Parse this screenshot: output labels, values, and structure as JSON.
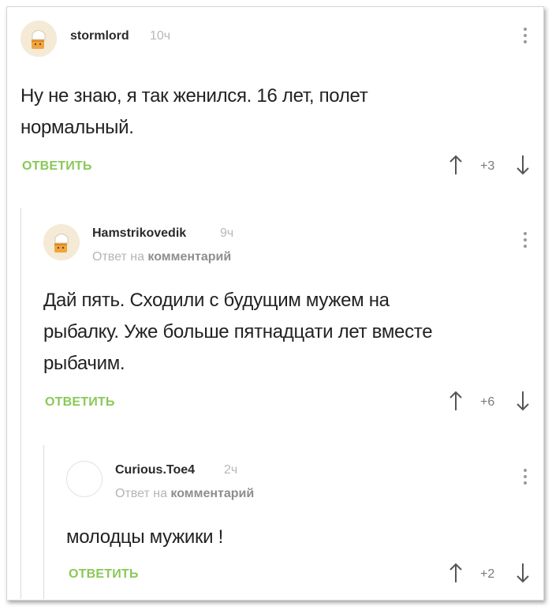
{
  "comments": [
    {
      "username": "stormlord",
      "time": "10ч",
      "text_lines": [
        "Ну не знаю, я так женился. 16 лет, полет",
        "нормальный."
      ],
      "reply_label": "ОТВЕТИТЬ",
      "score": "+3",
      "avatar_icon": "toast-avatar-icon"
    },
    {
      "username": "Hamstrikovedik",
      "time": "9ч",
      "reply_to_prefix": "Ответ на ",
      "reply_to_link": "комментарий",
      "text_lines": [
        "Дай пять. Сходили с будущим мужем на",
        "рыбалку. Уже больше пятнадцати лет вместе",
        "рыбачим."
      ],
      "reply_label": "ОТВЕТИТЬ",
      "score": "+6",
      "avatar_icon": "toast-avatar-icon"
    },
    {
      "username": "Curious.Toe4",
      "time": "2ч",
      "reply_to_prefix": "Ответ на ",
      "reply_to_link": "комментарий",
      "text_lines": [
        "молодцы мужики !"
      ],
      "reply_label": "ОТВЕТИТЬ",
      "score": "+2",
      "avatar_icon": "empty-avatar-icon"
    }
  ],
  "colors": {
    "accent_green": "#8ac858",
    "text": "#222222",
    "muted": "#b8b8b8"
  }
}
